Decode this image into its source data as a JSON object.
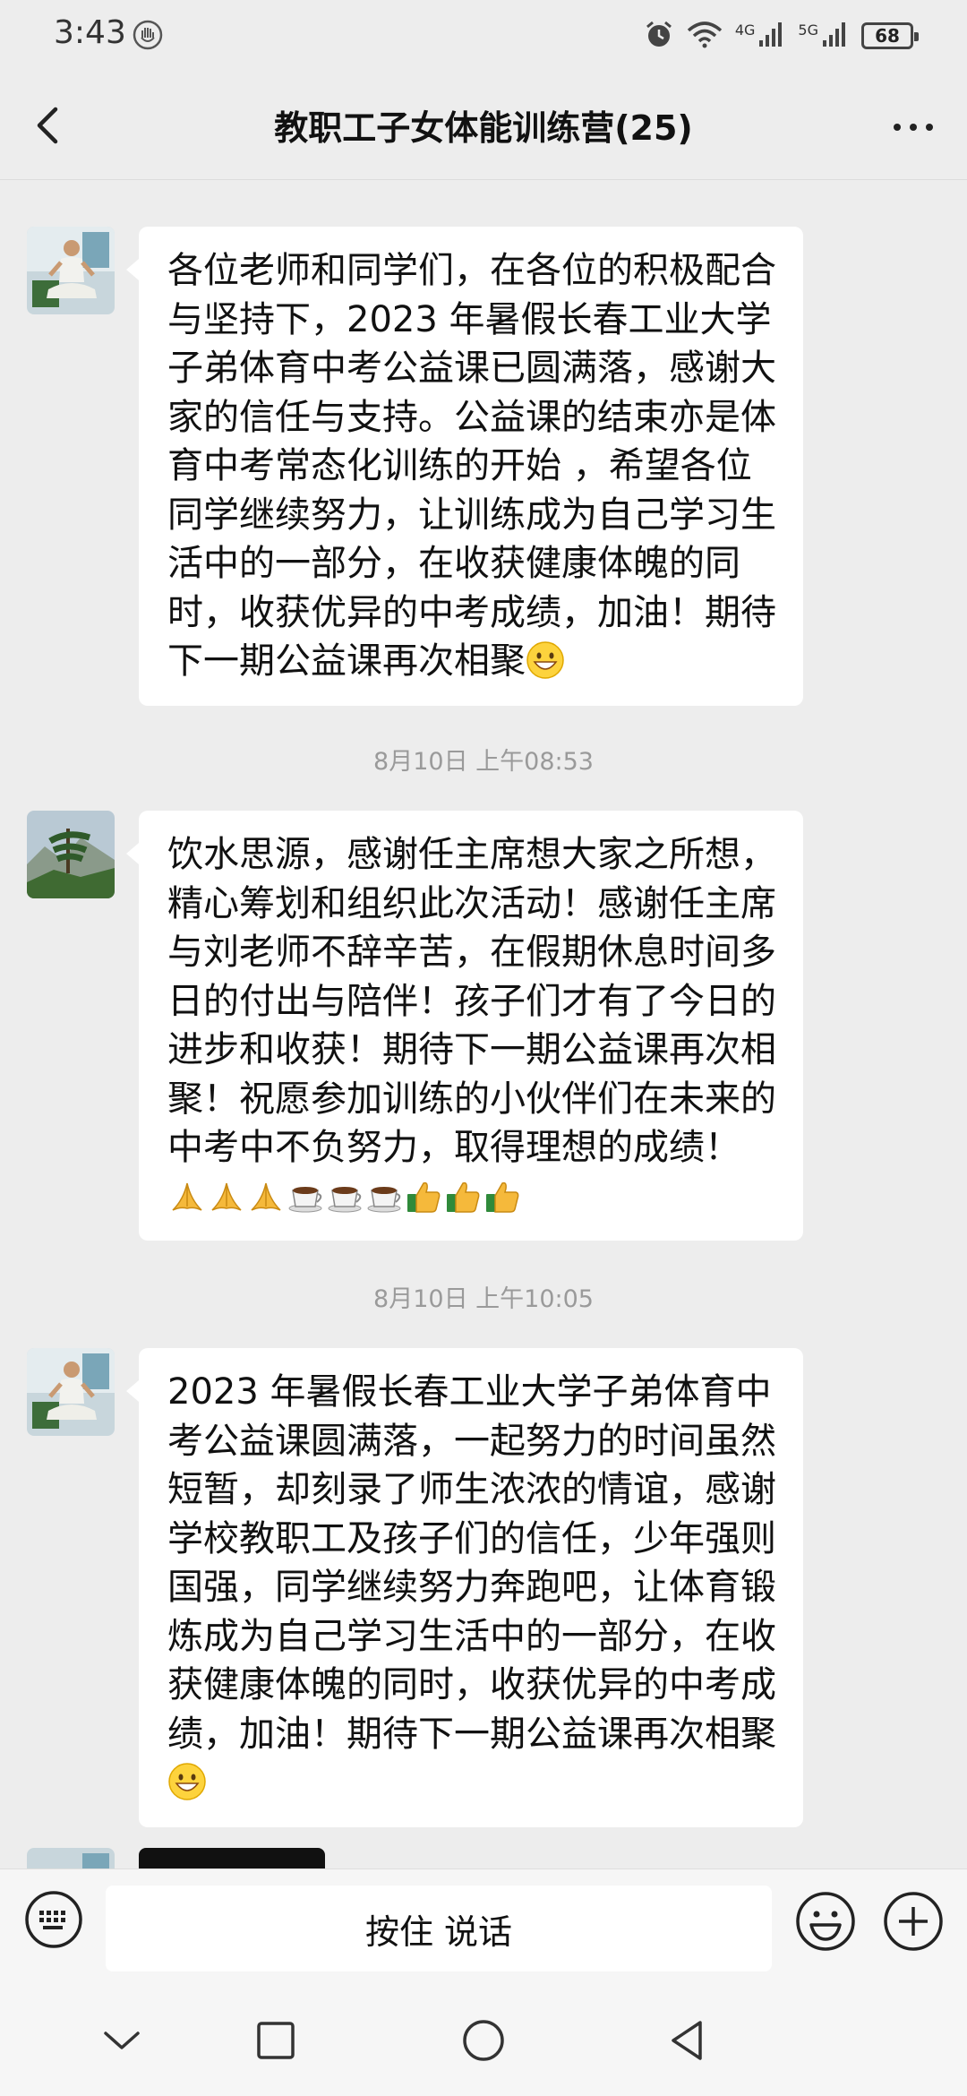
{
  "status_bar": {
    "time": "3:43",
    "battery": "68",
    "signal_1": "4G",
    "signal_2": "5G"
  },
  "header": {
    "title": "教职工子女体能训练营(25)"
  },
  "messages": [
    {
      "type": "text",
      "avatar": "meditating-man-avatar",
      "text": "各位老师和同学们，在各位的积极配合与坚持下，2023 年暑假长春工业大学子弟体育中考公益课已圆满落，感谢大家的信任与支持。公益课的结束亦是体育中考常态化训练的开始 ，希望各位同学继续努力，让训练成为自己学习生活中的一部分，在收获健康体魄的同时，收获优异的中考成绩，加油！期待下一期公益课再次相聚",
      "emoji": "grinning-face"
    },
    {
      "type": "timestamp",
      "text": "8月10日 上午08:53"
    },
    {
      "type": "text",
      "avatar": "landscape-pine-avatar",
      "text": "饮水思源，感谢任主席想大家之所想，精心筹划和组织此次活动！感谢任主席与刘老师不辞辛苦，在假期休息时间多日的付出与陪伴！孩子们才有了今日的进步和收获！期待下一期公益课再次相聚！祝愿参加训练的小伙伴们在未来的中考中不负努力，取得理想的成绩！",
      "emojis": [
        "folded-hands",
        "folded-hands",
        "folded-hands",
        "coffee-cup",
        "coffee-cup",
        "coffee-cup",
        "thumbs-up",
        "thumbs-up",
        "thumbs-up"
      ]
    },
    {
      "type": "timestamp",
      "text": "8月10日 上午10:05"
    },
    {
      "type": "text",
      "avatar": "meditating-man-avatar",
      "text": "2023 年暑假长春工业大学子弟体育中考公益课圆满落，一起努力的时间虽然短暂，却刻录了师生浓浓的情谊，感谢学校教职工及孩子们的信任，少年强则国强，同学继续努力奔跑吧，让体育锻炼成为自己学习生活中的一部分，在收获健康体魄的同时，收获优异的中考成绩，加油！期待下一期公益课再次相聚",
      "emoji": "grinning-face"
    }
  ],
  "input_bar": {
    "hold_to_talk": "按住 说话"
  },
  "nav_bar": {
    "buttons": [
      "chevron-down-icon",
      "square-icon",
      "circle-icon",
      "triangle-back-icon"
    ]
  },
  "colors": {
    "background": "#ededed",
    "bubble": "#ffffff",
    "timestamp": "#9a9a9a"
  }
}
